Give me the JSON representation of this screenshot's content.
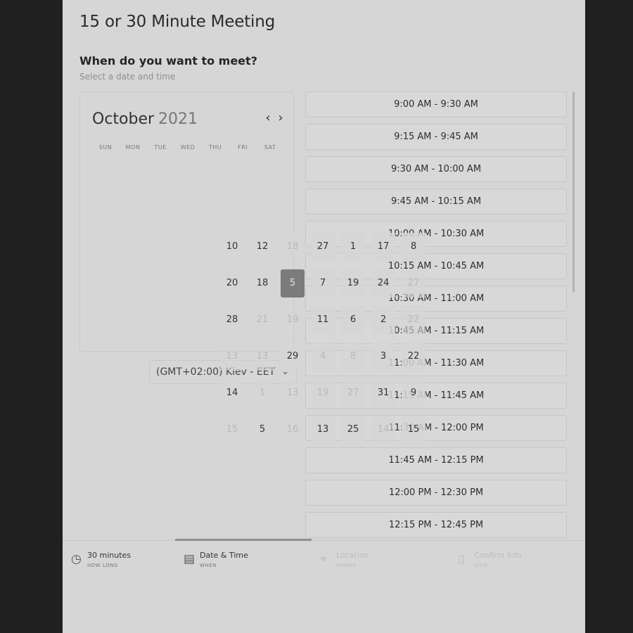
{
  "meeting": {
    "title": "15 or 30 Minute Meeting"
  },
  "prompt": {
    "heading": "When do you want to meet?",
    "subheading": "Select a date and time"
  },
  "calendar": {
    "month": "October",
    "year": "2021",
    "prev_icon": "chevron-left-icon",
    "next_icon": "chevron-right-icon",
    "weekdays": [
      "SUN",
      "MON",
      "TUE",
      "WED",
      "THU",
      "FRI",
      "SAT"
    ],
    "selected_day": "5",
    "rows": [
      [
        "10",
        "12",
        "18",
        "27",
        "1",
        "17",
        "8"
      ],
      [
        "20",
        "18",
        "5",
        "7",
        "19",
        "24",
        "27"
      ],
      [
        "28",
        "21",
        "19",
        "11",
        "6",
        "2",
        "22"
      ],
      [
        "13",
        "13",
        "29",
        "4",
        "8",
        "3",
        "22"
      ],
      [
        "14",
        "1",
        "13",
        "19",
        "27",
        "31",
        "9"
      ],
      [
        "15",
        "5",
        "16",
        "13",
        "25",
        "14",
        "15"
      ]
    ]
  },
  "timezone": {
    "value": "(GMT+02:00) Kiev - EET",
    "caret_icon": "chevron-down-icon"
  },
  "time_slots": [
    "9:00 AM - 9:30 AM",
    "9:15 AM - 9:45 AM",
    "9:30 AM - 10:00 AM",
    "9:45 AM - 10:15 AM",
    "10:00 AM - 10:30 AM",
    "10:15 AM - 10:45 AM",
    "10:30 AM - 11:00 AM",
    "10:45 AM - 11:15 AM",
    "11:00 AM - 11:30 AM",
    "11:15 AM - 11:45 AM",
    "11:30 AM - 12:00 PM",
    "11:45 AM - 12:15 PM",
    "12:00 PM - 12:30 PM",
    "12:15 PM - 12:45 PM"
  ],
  "steps": [
    {
      "label": "30 minutes",
      "caption": "HOW LONG",
      "icon": "clock-icon",
      "state": "done"
    },
    {
      "label": "Date & Time",
      "caption": "WHEN",
      "icon": "calendar-icon",
      "state": "active"
    },
    {
      "label": "Location",
      "caption": "WHERE",
      "icon": "location-pin-icon",
      "state": "pending"
    },
    {
      "label": "Confirm Info",
      "caption": "WHO",
      "icon": "note-icon",
      "state": "pending"
    }
  ]
}
